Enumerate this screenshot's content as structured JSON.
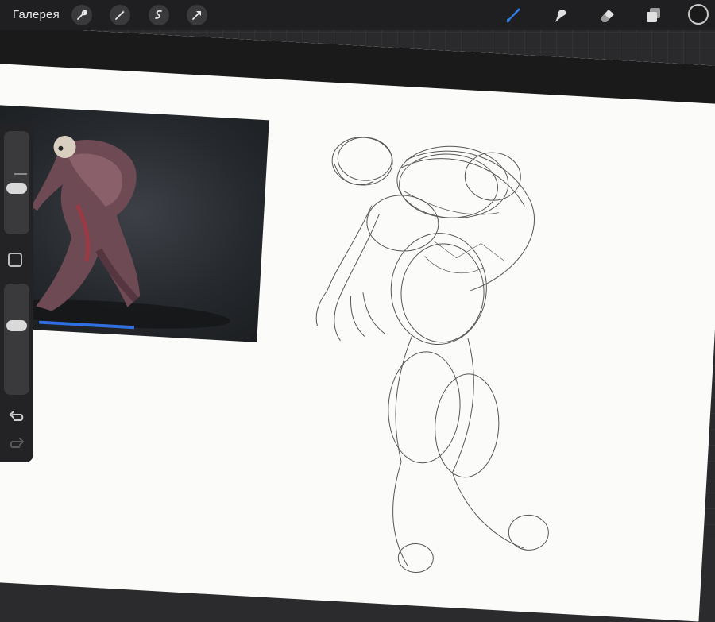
{
  "toolbar": {
    "gallery_label": "Галерея",
    "left_tools": [
      {
        "name": "wrench-icon"
      },
      {
        "name": "magic-wand-icon"
      },
      {
        "name": "selection-icon"
      },
      {
        "name": "transform-arrow-icon"
      }
    ],
    "right_tools": [
      {
        "name": "brush-icon",
        "active": true
      },
      {
        "name": "smudge-icon"
      },
      {
        "name": "eraser-icon"
      },
      {
        "name": "layers-icon"
      }
    ],
    "current_color": "#1a1a1a"
  },
  "sidebar": {
    "controls": [
      "brush-size-slider",
      "modify-button",
      "opacity-slider",
      "undo-icon",
      "redo-icon"
    ]
  },
  "colors": {
    "accent": "#2f7de1",
    "toolbar_bg": "#1f1f21",
    "canvas": "#fbfbf9"
  }
}
